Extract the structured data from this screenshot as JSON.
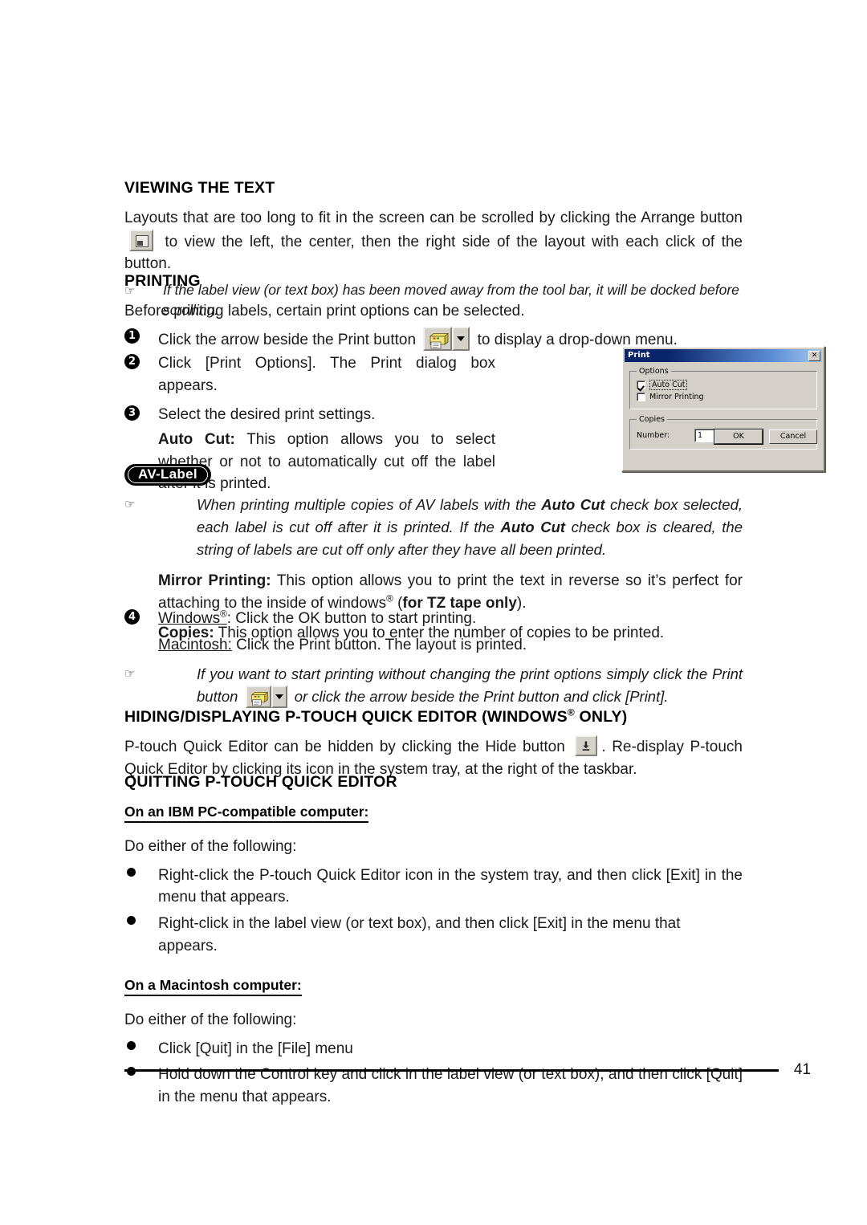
{
  "page": {
    "number": "41"
  },
  "sections": {
    "viewing": {
      "heading": "VIEWING THE TEXT",
      "para_part1": "Layouts that are too long to fit in the screen can be scrolled by clicking the Arrange button",
      "para_part2": "to view the left, the center, then the right side of the layout with each click of the button.",
      "note_symbol": "☞",
      "note": "If the label view (or text box) has been moved away from the tool bar, it will be docked before scrolling."
    },
    "printing": {
      "heading": "PRINTING",
      "intro": "Before printing labels, certain print options can be selected.",
      "steps": [
        {
          "num": "1",
          "text_before": "Click the arrow beside the Print button",
          "text_after": "to display a drop-down menu."
        },
        {
          "num": "2",
          "text": "Click [Print Options]. The Print dialog box appears."
        },
        {
          "num": "3",
          "text": "Select the desired print settings.",
          "option_label": "Auto Cut:",
          "option_text": " This option allows you to select whether or not to automatically cut off the label after it is printed."
        },
        {
          "num": "4",
          "os_windows_label": "Windows",
          "os_windows_sup": "®",
          "os_windows_text": ": Click the OK button to start printing.",
          "os_mac_label": "Macintosh:",
          "os_mac_text": " Click the Print button. The layout is printed."
        }
      ],
      "av_badge": "AV-Label",
      "av_note_symbol": "☞",
      "av_note_1": "When printing multiple copies of AV labels with the ",
      "av_note_bold_1": "Auto Cut",
      "av_note_2": " check box selected, each label is cut off after it is printed. If the ",
      "av_note_bold_2": "Auto Cut",
      "av_note_3": " check box is cleared, the string of labels are cut off only after they have all been printed.",
      "mirror_label": "Mirror Printing:",
      "mirror_text_1": " This option allows you to print the text in reverse so it’s perfect for attaching to the inside of windows",
      "mirror_sup": "®",
      "mirror_text_2": " (",
      "mirror_bold": "for TZ tape only",
      "mirror_text_3": ").",
      "copies_label": "Copies:",
      "copies_text": " This option allows you to enter the number of copies to be printed.",
      "final_note_symbol": "☞",
      "final_note_1": "If you want to start printing without changing the print options simply click the Print button",
      "final_note_2": "or click the arrow beside the Print button and click [Print]."
    },
    "hiding": {
      "heading_1": "HIDING/DISPLAYING P-TOUCH QUICK EDITOR (WINDOWS",
      "heading_sup": "®",
      "heading_2": " ONLY)",
      "text_1": "P-touch Quick Editor can be hidden by clicking the Hide button",
      "text_2": ". Re-display P-touch Quick Editor by clicking its icon in the system tray, at the right of the taskbar."
    },
    "quitting": {
      "heading": "QUITTING P-TOUCH QUICK EDITOR",
      "ibm_subhead": "On an IBM PC-compatible computer:",
      "ibm_lead": "Do either of the following:",
      "ibm_bullets": [
        "Right-click the P-touch Quick Editor icon in the system tray, and then click [Exit] in the menu that appears.",
        "Right-click in the label view (or text box), and then click [Exit] in the menu that appears."
      ],
      "mac_subhead": "On a Macintosh computer:",
      "mac_lead": "Do either of the following:",
      "mac_bullets": [
        "Click [Quit] in the [File] menu",
        "Hold down the Control key and click in the label view (or text box), and then click [Quit] in the menu that appears."
      ]
    }
  },
  "print_dialog": {
    "title": "Print",
    "close_label": "✕",
    "options_group": "Options",
    "auto_cut_label": "Auto Cut",
    "auto_cut_checked": true,
    "mirror_printing_label": "Mirror Printing",
    "mirror_printing_checked": false,
    "copies_group": "Copies",
    "number_label": "Number:",
    "number_value": "1",
    "ok_label": "OK",
    "cancel_label": "Cancel"
  },
  "icons": {
    "arrange_button": "arrange-window-icon",
    "print_button": "printer-icon",
    "dropdown_arrow": "chevron-down-icon",
    "hide_button": "hide-down-arrow-icon",
    "note_hand": "pointing-hand-icon"
  },
  "colors": {
    "printer_body": "#e8d24a",
    "printer_shadow": "#b9a226",
    "button_face": "#d4d0c8",
    "title_bar": "#0a246a",
    "text": "#1a1a1a"
  }
}
